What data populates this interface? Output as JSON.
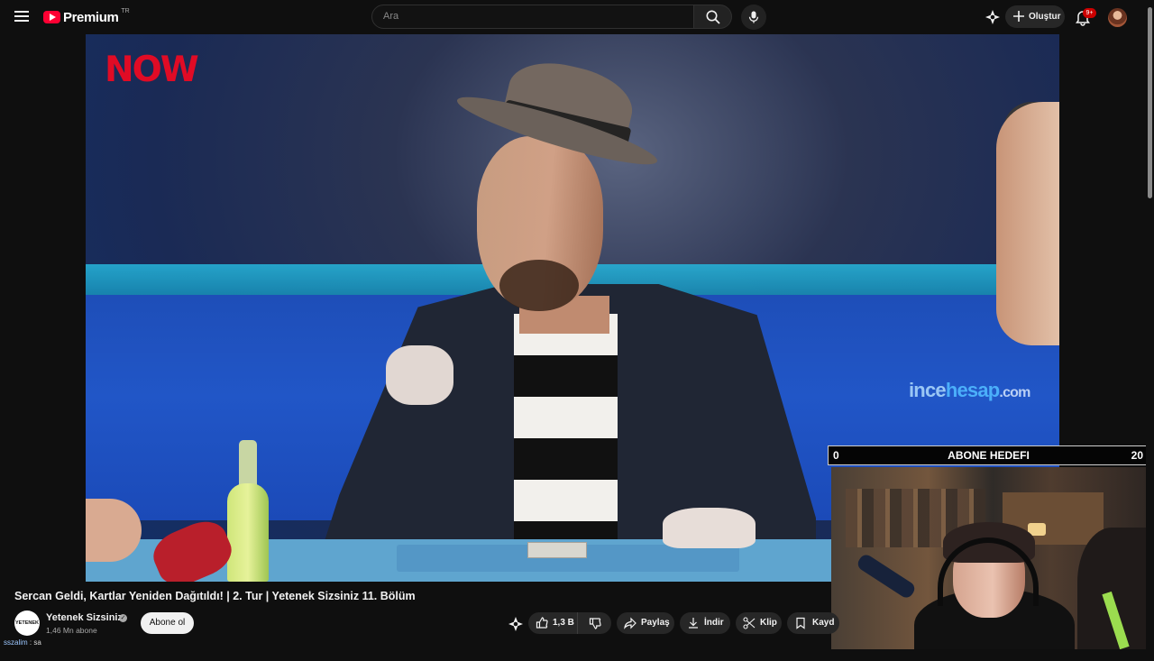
{
  "header": {
    "logo_label": "Premium",
    "region": "TR",
    "search_placeholder": "Ara",
    "create_label": "Oluştur",
    "notification_count": "9+",
    "icons": [
      "menu-icon",
      "youtube-logo-icon",
      "search-icon",
      "microphone-icon",
      "sparkle-icon",
      "plus-icon",
      "bell-icon",
      "avatar"
    ]
  },
  "video": {
    "brand_overlay": "NOW",
    "watermark": {
      "part1": "ince",
      "part2": "hesap",
      "part3": ".com"
    }
  },
  "goal": {
    "start": "0",
    "title": "ABONE HEDEFI",
    "target": "20"
  },
  "details": {
    "title": "Sercan Geldi, Kartlar Yeniden Dağıtıldı! | 2. Tur | Yetenek Sizsiniz 11. Bölüm",
    "channel_avatar_text": "YETENEK SIZSINIZ",
    "channel_name": "Yetenek Sizsiniz",
    "subscribers": "1,46 Mn abone",
    "subscribe_label": "Abone ol",
    "actions": {
      "likes": "1,3 B",
      "share": "Paylaş",
      "download": "İndir",
      "clip": "Klip",
      "save": "Kayd"
    }
  },
  "chat": {
    "username": "sszalim",
    "separator": ":",
    "message": "sa"
  },
  "colors": {
    "background": "#0f0f0f",
    "accent_red": "#ff0033",
    "button_surface": "#272727",
    "text_primary": "#f1f1f1"
  }
}
